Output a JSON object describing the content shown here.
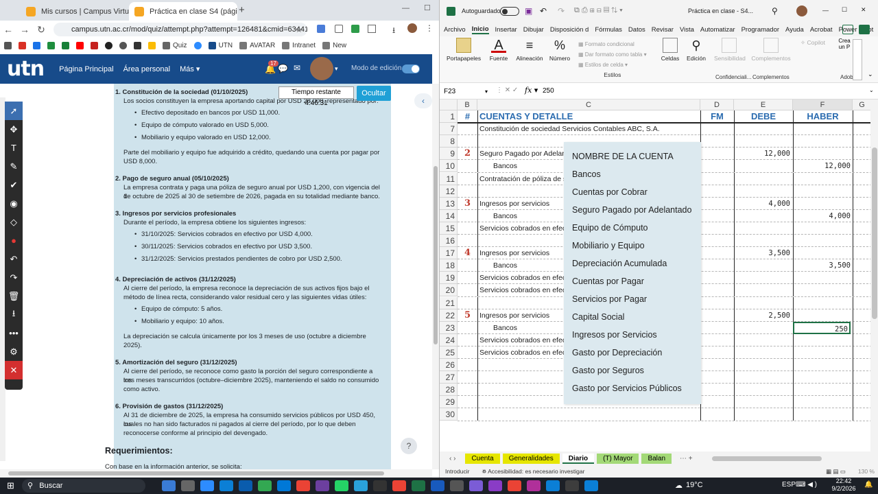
{
  "browser": {
    "tabs": [
      {
        "label": "Mis cursos | Campus Virtual UT",
        "active": false
      },
      {
        "label": "Práctica en clase S4 (página 1 d",
        "active": true
      }
    ],
    "url": "campus.utn.ac.cr/mod/quiz/attempt.php?attempt=126481&cmid=634418#",
    "bookmarks": [
      "Quiz",
      "UTN",
      "AVATAR",
      "Intranet",
      "New"
    ],
    "moodle": {
      "logo": "utn",
      "nav": [
        "Página Principal",
        "Área personal",
        "Más"
      ],
      "badge": "17",
      "edit_mode": "Modo de edición"
    },
    "timer": "Tiempo restante 4:46:31",
    "hide_button": "Ocultar",
    "help": "?",
    "quiz": {
      "sections": [
        {
          "title": "1. Constitución de la sociedad (01/10/2025)",
          "lines": [
            "Los socios constituyen la empresa aportando capital por USD 28,000, representado por:"
          ],
          "bullets": [
            "Efectivo depositado en bancos por USD 11,000.",
            "Equipo de cómputo valorado en USD 5,000.",
            "Mobiliario y equipo valorado en USD 12,000."
          ],
          "after": [
            "Parte del mobiliario y equipo fue adquirido a crédito, quedando una cuenta por pagar por",
            "USD 8,000."
          ]
        },
        {
          "title": "2. Pago de seguro anual (05/10/2025)",
          "lines": [
            "La empresa contrata y paga una póliza de seguro anual por USD 1,200, con vigencia del 1",
            "de octubre de 2025 al 30 de setiembre de 2026, pagada en su totalidad mediante banco."
          ],
          "bullets": [],
          "after": []
        },
        {
          "title": "3. Ingresos por servicios profesionales",
          "lines": [
            "Durante el período, la empresa obtiene los siguientes ingresos:"
          ],
          "bullets": [
            "31/10/2025: Servicios cobrados en efectivo por USD 4,000.",
            "30/11/2025: Servicios cobrados en efectivo por USD 3,500.",
            "31/12/2025: Servicios prestados pendientes de cobro por USD 2,500."
          ],
          "after": []
        },
        {
          "title": "4. Depreciación de activos (31/12/2025)",
          "lines": [
            "Al cierre del período, la empresa reconoce la depreciación de sus activos fijos bajo el",
            "método de línea recta, considerando valor residual cero y las siguientes vidas útiles:"
          ],
          "bullets": [
            "Equipo de cómputo: 5 años.",
            "Mobiliario y equipo: 10 años."
          ],
          "after": [
            "La depreciación se calcula únicamente por los 3 meses de uso (octubre a diciembre",
            "2025)."
          ]
        },
        {
          "title": "5. Amortización del seguro (31/12/2025)",
          "lines": [
            "Al cierre del período, se reconoce como gasto la porción del seguro correspondiente a los",
            "tres meses transcurridos (octubre–diciembre 2025), manteniendo el saldo no consumido",
            "como activo."
          ],
          "bullets": [],
          "after": []
        },
        {
          "title": "6. Provisión de gastos (31/12/2025)",
          "lines": [
            "Al 31 de diciembre de 2025, la empresa ha consumido servicios públicos por USD 450, los",
            "cuales no han sido facturados ni pagados al cierre del período, por lo que deben",
            "reconocerse conforme al principio del devengado."
          ],
          "bullets": [],
          "after": []
        }
      ],
      "requirements_title": "Requerimientos:",
      "requirements_intro": "Con base en la información anterior, se solicita:"
    }
  },
  "excel": {
    "autosave": "Autoguardado",
    "doc_title": "Práctica en clase - S4...",
    "menu": [
      "Archivo",
      "Inicio",
      "Insertar",
      "Dibujar",
      "Disposición d",
      "Fórmulas",
      "Datos",
      "Revisar",
      "Vista",
      "Automatizar",
      "Programador",
      "Ayuda",
      "Acrobat",
      "Power Pivot"
    ],
    "ribbon": {
      "portapapeles": "Portapapeles",
      "fuente": "Fuente",
      "alineacion": "Alineación",
      "numero": "Número",
      "formato_condicional": "Formato condicional",
      "dar_formato_tabla": "Dar formato como tabla",
      "estilos_celda": "Estilos de celda",
      "estilos": "Estilos",
      "celdas": "Celdas",
      "edicion": "Edición",
      "sensibilidad": "Sensibilidad",
      "complementos": "Complementos",
      "confidencial": "Confidenciali...",
      "copilot": "Copilot",
      "crear": "Crea un P",
      "adobe": "Adob"
    },
    "name_box": "F23",
    "formula": "250",
    "columns": [
      "B",
      "C",
      "D",
      "E",
      "F",
      "G"
    ],
    "header_row": {
      "num": "#",
      "detalle": "CUENTAS Y DETALLE",
      "fm": "FM",
      "debe": "DEBE",
      "haber": "HABER"
    },
    "rows": [
      {
        "n": "7",
        "mark": "",
        "detail": "Constitución de sociedad Servicios Contables ABC, S.A.",
        "indent": false,
        "debe": "",
        "haber": ""
      },
      {
        "n": "8",
        "mark": "",
        "detail": "",
        "indent": false,
        "debe": "",
        "haber": ""
      },
      {
        "n": "9",
        "mark": "2",
        "detail": "Seguro Pagado por Adelant",
        "indent": false,
        "debe": "12,000",
        "haber": ""
      },
      {
        "n": "10",
        "mark": "",
        "detail": "Bancos",
        "indent": true,
        "debe": "",
        "haber": "12,000"
      },
      {
        "n": "11",
        "mark": "",
        "detail": "Contratación de póliza de s",
        "indent": false,
        "debe": "",
        "haber": ""
      },
      {
        "n": "12",
        "mark": "",
        "detail": "",
        "indent": false,
        "debe": "",
        "haber": ""
      },
      {
        "n": "13",
        "mark": "3",
        "detail": "Ingresos por servicios",
        "indent": false,
        "debe": "4,000",
        "haber": ""
      },
      {
        "n": "14",
        "mark": "",
        "detail": "Bancos",
        "indent": true,
        "debe": "",
        "haber": "4,000"
      },
      {
        "n": "15",
        "mark": "",
        "detail": "Servicios cobrados en efect",
        "indent": false,
        "debe": "",
        "haber": ""
      },
      {
        "n": "16",
        "mark": "",
        "detail": "",
        "indent": false,
        "debe": "",
        "haber": ""
      },
      {
        "n": "17",
        "mark": "4",
        "detail": "Ingresos por servicios",
        "indent": false,
        "debe": "3,500",
        "haber": ""
      },
      {
        "n": "18",
        "mark": "",
        "detail": "Bancos",
        "indent": true,
        "debe": "",
        "haber": "3,500"
      },
      {
        "n": "19",
        "mark": "",
        "detail": "Servicios cobrados en efect",
        "indent": false,
        "debe": "",
        "haber": ""
      },
      {
        "n": "20",
        "mark": "",
        "detail": "Servicios cobrados en efect",
        "indent": false,
        "debe": "",
        "haber": ""
      },
      {
        "n": "21",
        "mark": "",
        "detail": "",
        "indent": false,
        "debe": "",
        "haber": ""
      },
      {
        "n": "22",
        "mark": "5",
        "detail": "Ingresos por servicios",
        "indent": false,
        "debe": "2,500",
        "haber": ""
      },
      {
        "n": "23",
        "mark": "",
        "detail": "Bancos",
        "indent": true,
        "debe": "",
        "haber": "250"
      },
      {
        "n": "24",
        "mark": "",
        "detail": "Servicios cobrados en efect",
        "indent": false,
        "debe": "",
        "haber": ""
      },
      {
        "n": "25",
        "mark": "",
        "detail": "Servicios cobrados en efect",
        "indent": false,
        "debe": "",
        "haber": ""
      },
      {
        "n": "26",
        "mark": "",
        "detail": "",
        "indent": false,
        "debe": "",
        "haber": ""
      },
      {
        "n": "27",
        "mark": "",
        "detail": "",
        "indent": false,
        "debe": "",
        "haber": ""
      },
      {
        "n": "28",
        "mark": "",
        "detail": "",
        "indent": false,
        "debe": "",
        "haber": ""
      },
      {
        "n": "29",
        "mark": "",
        "detail": "",
        "indent": false,
        "debe": "",
        "haber": ""
      },
      {
        "n": "30",
        "mark": "",
        "detail": "",
        "indent": false,
        "debe": "",
        "haber": ""
      }
    ],
    "dropdown": [
      "NOMBRE DE LA CUENTA",
      "Bancos",
      "Cuentas por Cobrar",
      "Seguro Pagado por Adelantado",
      "Equipo de Cómputo",
      "Mobiliario y Equipo",
      "Depreciación Acumulada",
      "Cuentas por Pagar",
      "Servicios por Pagar",
      "Capital Social",
      "Ingresos por Servicios",
      "Gasto por Depreciación",
      "Gasto por Seguros",
      "Gasto por Servicios Públicos"
    ],
    "sheets": [
      {
        "label": "Cuenta",
        "color": "#e6e600"
      },
      {
        "label": "Generalidades",
        "color": "#e6e600"
      },
      {
        "label": "Diario",
        "color": "#ffffff"
      },
      {
        "label": "(T) Mayor",
        "color": "#a3d977"
      },
      {
        "label": "Balan",
        "color": "#a3d977"
      }
    ],
    "status": {
      "mode": "Introducir",
      "accessibility": "Accesibilidad: es necesario investigar",
      "zoom": "130 %"
    }
  },
  "taskbar": {
    "search": "Buscar",
    "weather": "19°C",
    "lang": "ESP",
    "time": "22:42",
    "date": "9/2/2026"
  }
}
